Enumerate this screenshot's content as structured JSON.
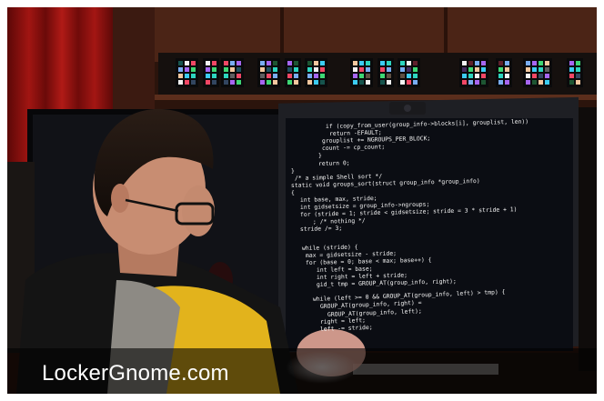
{
  "watermark": {
    "text": "LockerGnome.com"
  },
  "monitor": {
    "code_lines": [
      "if (copy_from_user(group_info->blocks[i], grouplist, len))",
      "return -EFAULT;",
      "grouplist += NGROUPS_PER_BLOCK;",
      "count -= cp_count;",
      "}",
      "return 0;",
      "}",
      "/* a simple Shell sort */",
      "static void groups_sort(struct group_info *group_info)",
      "{",
      "int base, max, stride;",
      "int gidsetsize = group_info->ngroups;",
      "for (stride = 1; stride < gidsetsize; stride = 3 * stride + 1)",
      "; /* nothing */",
      "stride /= 3;",
      "",
      "while (stride) {",
      "max = gidsetsize - stride;",
      "for (base = 0; base < max; base++) {",
      "int left = base;",
      "int right = left + stride;",
      "gid_t tmp = GROUP_AT(group_info, right);",
      "",
      "while (left >= 0 && GROUP_AT(group_info, left) > tmp) {",
      "GROUP_AT(group_info, right) =",
      "GROUP_AT(group_info, left);",
      "right = left;",
      "left -= stride;"
    ]
  },
  "colors": {
    "curtain": "#8e0f0e",
    "wood": "#3a1c12",
    "screen": "#0b0d13",
    "code_text": "#f2f2f2",
    "shirt_yellow": "#e7b91c",
    "shirt_black": "#141414",
    "skin": "#c88d72"
  },
  "icons": [
    "led-light-panel-icon"
  ]
}
